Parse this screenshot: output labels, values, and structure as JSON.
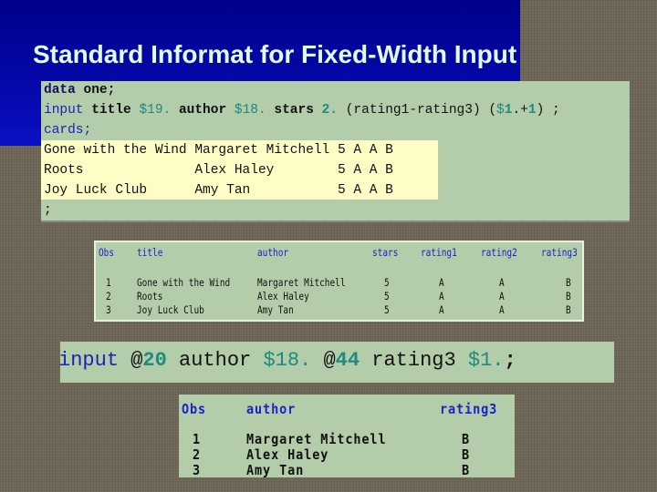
{
  "slide": {
    "title": "Standard Informat for Fixed-Width Input"
  },
  "code": {
    "line1": {
      "kw": "data",
      "rest": " one;"
    },
    "line2": {
      "kw": "input",
      "tokens": [
        {
          "t": " title ",
          "c": "plain-b"
        },
        {
          "t": "$19.",
          "c": "fmt"
        },
        {
          "t": " author ",
          "c": "plain-b"
        },
        {
          "t": "$18.",
          "c": "fmt"
        },
        {
          "t": " stars ",
          "c": "plain-b"
        },
        {
          "t": "2.",
          "c": "fmt-b"
        },
        {
          "t": " (rating1-rating3) (",
          "c": "plain"
        },
        {
          "t": "$",
          "c": "fmt"
        },
        {
          "t": "1",
          "c": "fmt-b"
        },
        {
          "t": ".+",
          "c": "plain"
        },
        {
          "t": "1",
          "c": "fmt-b"
        },
        {
          "t": ") ;",
          "c": "plain"
        }
      ]
    },
    "line3": {
      "kw": "cards;"
    },
    "datalines": [
      "Gone with the Wind Margaret Mitchell 5 A A B",
      "Roots              Alex Haley        5 A A B",
      "Joy Luck Club      Amy Tan           5 A A B"
    ],
    "line_end": ";"
  },
  "output1": {
    "headers": [
      "Obs",
      "title",
      "author",
      "stars",
      "rating1",
      "rating2",
      "rating3"
    ],
    "rows": [
      [
        "1",
        "Gone with the Wind",
        "Margaret Mitchell",
        "5",
        "A",
        "A",
        "B"
      ],
      [
        "2",
        "Roots",
        "Alex Haley",
        "5",
        "A",
        "A",
        "B"
      ],
      [
        "3",
        "Joy Luck Club",
        "Amy Tan",
        "5",
        "A",
        "A",
        "B"
      ]
    ]
  },
  "input_statement": {
    "tokens": [
      {
        "t": "input",
        "c": "kw-blue"
      },
      {
        "t": " @",
        "c": "plain"
      },
      {
        "t": "20",
        "c": "fmt-b"
      },
      {
        "t": " author ",
        "c": "plain"
      },
      {
        "t": "$18.",
        "c": "fmt"
      },
      {
        "t": " @",
        "c": "plain"
      },
      {
        "t": "44",
        "c": "fmt-b"
      },
      {
        "t": " rating3 ",
        "c": "plain"
      },
      {
        "t": "$1.",
        "c": "fmt"
      },
      {
        "t": ";",
        "c": "plain-b"
      }
    ]
  },
  "output2": {
    "headers": [
      "Obs",
      "author",
      "rating3"
    ],
    "rows": [
      [
        "1",
        "Margaret Mitchell",
        "B"
      ],
      [
        "2",
        "Alex Haley",
        "B"
      ],
      [
        "3",
        "Amy Tan",
        "B"
      ]
    ]
  },
  "colors": {
    "slide_blue": "#00008a",
    "title_text": "#e0fbff",
    "code_bg": "#b3ccaa",
    "datalines_bg": "#fefdc6",
    "keyword_blue": "#1a22b8",
    "format_teal": "#1f8a80",
    "header_blue": "#1a22c8",
    "texture_brown": "#6e6656"
  }
}
